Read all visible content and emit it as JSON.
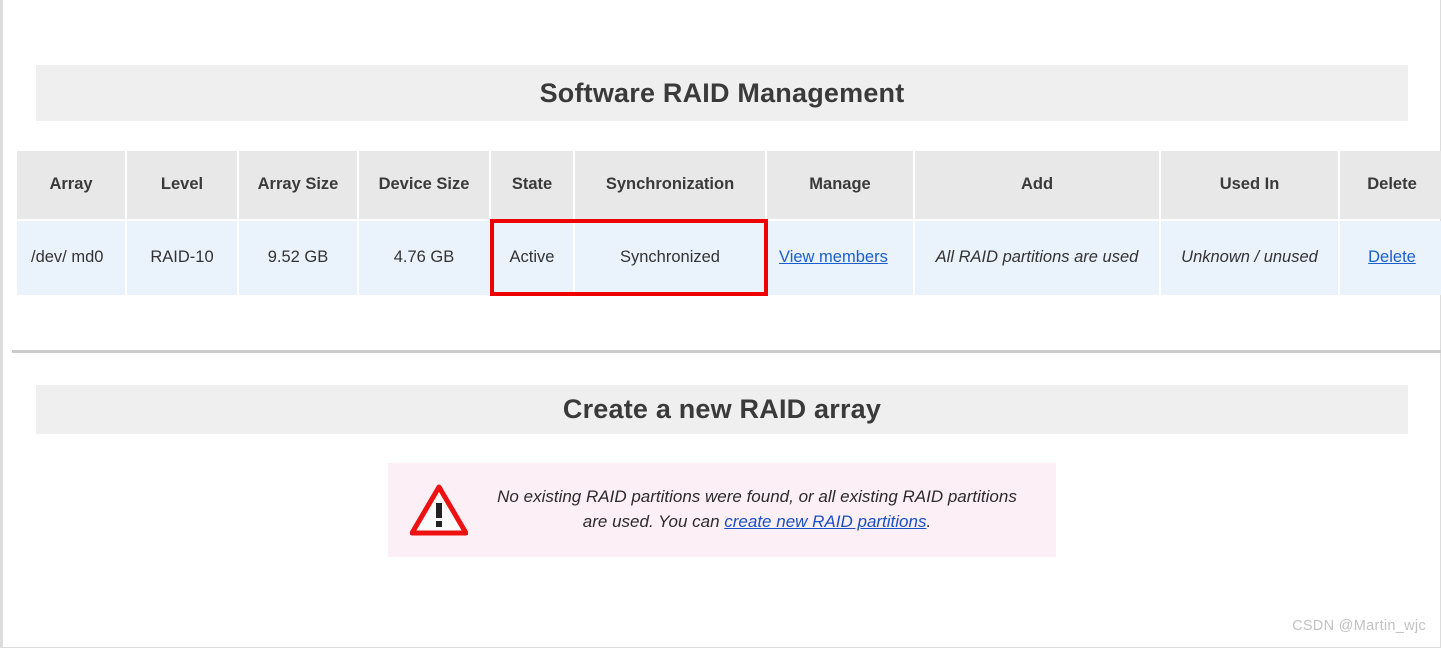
{
  "sections": {
    "main_title": "Software RAID Management",
    "create_title": "Create a new RAID array"
  },
  "table": {
    "headers": [
      "Array",
      "Level",
      "Array Size",
      "Device Size",
      "State",
      "Synchronization",
      "Manage",
      "Add",
      "Used In",
      "Delete"
    ],
    "rows": [
      {
        "array": "/dev/ md0",
        "level": "RAID-10",
        "array_size": "9.52 GB",
        "device_size": "4.76 GB",
        "state": "Active",
        "synchronization": "Synchronized",
        "manage": "View members",
        "add": "All RAID partitions are used",
        "used_in": "Unknown / unused",
        "delete": "Delete"
      }
    ]
  },
  "highlight": {
    "color": "#ef0000",
    "covers": "State and Synchronization cells"
  },
  "warning": {
    "icon": "warning-triangle-icon",
    "text_before_link": "No existing RAID partitions were found, or all existing RAID partitions are used. You can ",
    "link_text": "create new RAID partitions",
    "text_after_link": ".",
    "background_color": "#fdeff6",
    "icon_color": "#ee1111"
  },
  "watermark": {
    "text": "CSDN @Martin_wjc"
  },
  "colors": {
    "banner_background": "#efefef",
    "table_header_background": "#e8e8e8",
    "table_cell_background": "#eaf2fb",
    "link_color": "#1a5fd0",
    "highlight_border": "#ef0000"
  }
}
